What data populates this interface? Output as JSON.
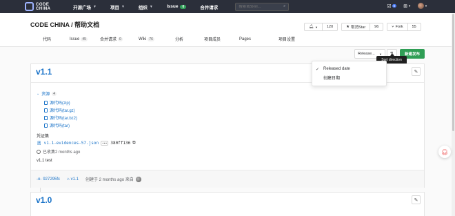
{
  "nav": {
    "logo_line1": "CODE",
    "logo_line2": "CHINA",
    "items": [
      {
        "label": "开源广场",
        "dropdown": true
      },
      {
        "label": "项目",
        "dropdown": true
      },
      {
        "label": "组织",
        "dropdown": true
      },
      {
        "label": "Issue",
        "badge": "0"
      },
      {
        "label": "合并请求"
      }
    ],
    "search_placeholder": "搜索或转到...",
    "todo_badge": "0"
  },
  "repo": {
    "title": "CODE CHINA / 帮助文档",
    "watch_count": "120",
    "star_label": "取消Star",
    "star_count": "96",
    "fork_label": "Fork",
    "fork_count": "55"
  },
  "tabs": [
    {
      "label": "代码"
    },
    {
      "label": "Issue",
      "count": "45"
    },
    {
      "label": "合并请求",
      "count": "0"
    },
    {
      "label": "Wiki",
      "count": "76"
    },
    {
      "label": "分析"
    },
    {
      "label": "项目成员"
    },
    {
      "label": "Pages"
    },
    {
      "label": "项目设置"
    }
  ],
  "toolbar": {
    "sort_select_label": "Release...",
    "sort_direction_tooltip": "Sort direction",
    "new_release_label": "新建发布"
  },
  "sort_dropdown": {
    "options": [
      {
        "label": "Released date",
        "checked": true
      },
      {
        "label": "创建日期",
        "checked": false
      }
    ]
  },
  "releases": [
    {
      "title": "v1.1",
      "assets_label": "资源",
      "assets_count": "4",
      "assets": [
        "源代码(zip)",
        "源代码(tar.gz)",
        "源代码(tar.bz2)",
        "源代码(tar)"
      ],
      "evidence_label": "凭证集",
      "evidence_file": "v1.1-evidences-57.json",
      "evidence_hash": "380ff136",
      "collected_text": "已收集2 months ago",
      "description": "v1.1 test",
      "commit": "927295fc",
      "tag": "v1.1",
      "created_text": "创建于 2 months ago 来自"
    },
    {
      "title": "v1.0"
    }
  ]
}
